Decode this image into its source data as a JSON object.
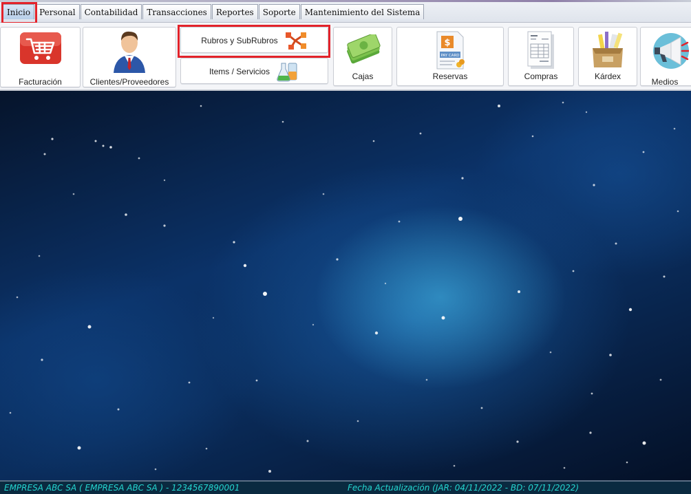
{
  "menu": {
    "tabs": [
      {
        "label": "Inicio",
        "active": true
      },
      {
        "label": "Personal"
      },
      {
        "label": "Contabilidad"
      },
      {
        "label": "Transacciones"
      },
      {
        "label": "Reportes"
      },
      {
        "label": "Soporte"
      },
      {
        "label": "Mantenimiento del Sistema"
      }
    ]
  },
  "ribbon": {
    "facturacion": {
      "label": "Facturación",
      "icon": "shopping-cart-icon"
    },
    "clientes": {
      "label": "Clientes/Proveedores",
      "icon": "businessman-icon"
    },
    "rubros": {
      "label": "Rubros y SubRubros",
      "icon": "hierarchy-icon"
    },
    "items": {
      "label": "Items / Servicios",
      "icon": "flask-icon"
    },
    "cajas": {
      "label": "Cajas",
      "icon": "money-icon"
    },
    "reservas": {
      "label": "Reservas",
      "icon": "pay-card-icon"
    },
    "compras": {
      "label": "Compras",
      "icon": "invoice-icon"
    },
    "kardex": {
      "label": "Kárdex",
      "icon": "inventory-box-icon"
    },
    "medios": {
      "label": "Medios",
      "icon": "megaphone-icon"
    }
  },
  "status": {
    "company": "EMPRESA ABC SA    (   EMPRESA ABC SA   )   -    1234567890001",
    "updated": "Fecha Actualización (JAR: 04/11/2022 - BD: 07/11/2022)",
    "text_color": "#25d6d0"
  },
  "colors": {
    "highlight": "#e3222a",
    "cart_red": "#d9352b",
    "space_blue": "#0b3268"
  }
}
